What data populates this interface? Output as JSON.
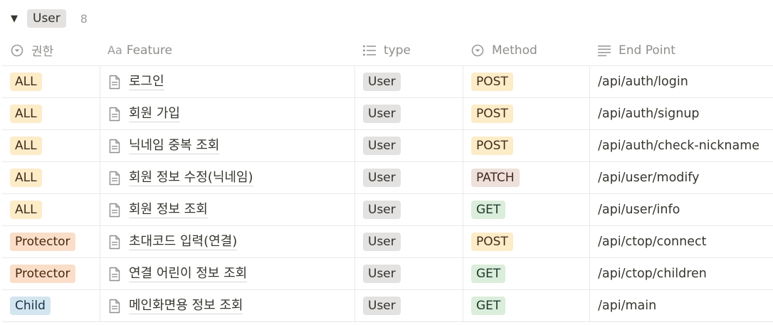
{
  "group": {
    "name": "User",
    "count": "8"
  },
  "columns": [
    {
      "label": "권한",
      "icon": "select-icon"
    },
    {
      "label": "Feature",
      "icon": "title-aa-icon",
      "icon_text": "Aa"
    },
    {
      "label": "type",
      "icon": "list-icon"
    },
    {
      "label": "Method",
      "icon": "select-icon"
    },
    {
      "label": "End Point",
      "icon": "text-lines-icon"
    }
  ],
  "rows": [
    {
      "role": "ALL",
      "feature": "로그인",
      "type": "User",
      "method": "POST",
      "endpoint": "/api/auth/login"
    },
    {
      "role": "ALL",
      "feature": "회원 가입",
      "type": "User",
      "method": "POST",
      "endpoint": "/api/auth/signup"
    },
    {
      "role": "ALL",
      "feature": "닉네임 중복 조회",
      "type": "User",
      "method": "POST",
      "endpoint": "/api/auth/check-nickname"
    },
    {
      "role": "ALL",
      "feature": "회원 정보 수정(닉네임)",
      "type": "User",
      "method": "PATCH",
      "endpoint": "/api/user/modify"
    },
    {
      "role": "ALL",
      "feature": "회원 정보 조회",
      "type": "User",
      "method": "GET",
      "endpoint": "/api/user/info"
    },
    {
      "role": "Protector",
      "feature": "초대코드 입력(연결)",
      "type": "User",
      "method": "POST",
      "endpoint": "/api/ctop/connect"
    },
    {
      "role": "Protector",
      "feature": "연결 어린이 정보 조회",
      "type": "User",
      "method": "GET",
      "endpoint": "/api/ctop/children"
    },
    {
      "role": "Child",
      "feature": "메인화면용 정보 조회",
      "type": "User",
      "method": "GET",
      "endpoint": "/api/main"
    }
  ],
  "tag_colors": {
    "ALL": {
      "bg": "#fdecc8",
      "fg": "#402c1b"
    },
    "Protector": {
      "bg": "#fadec9",
      "fg": "#49290e"
    },
    "Child": {
      "bg": "#d3e5ef",
      "fg": "#183347"
    },
    "User": {
      "bg": "#e3e2e0",
      "fg": "#32302c"
    },
    "POST": {
      "bg": "#fdecc8",
      "fg": "#402c1b"
    },
    "PATCH": {
      "bg": "#eee0da",
      "fg": "#442a1e"
    },
    "GET": {
      "bg": "#dbeddb",
      "fg": "#1c3829"
    }
  }
}
